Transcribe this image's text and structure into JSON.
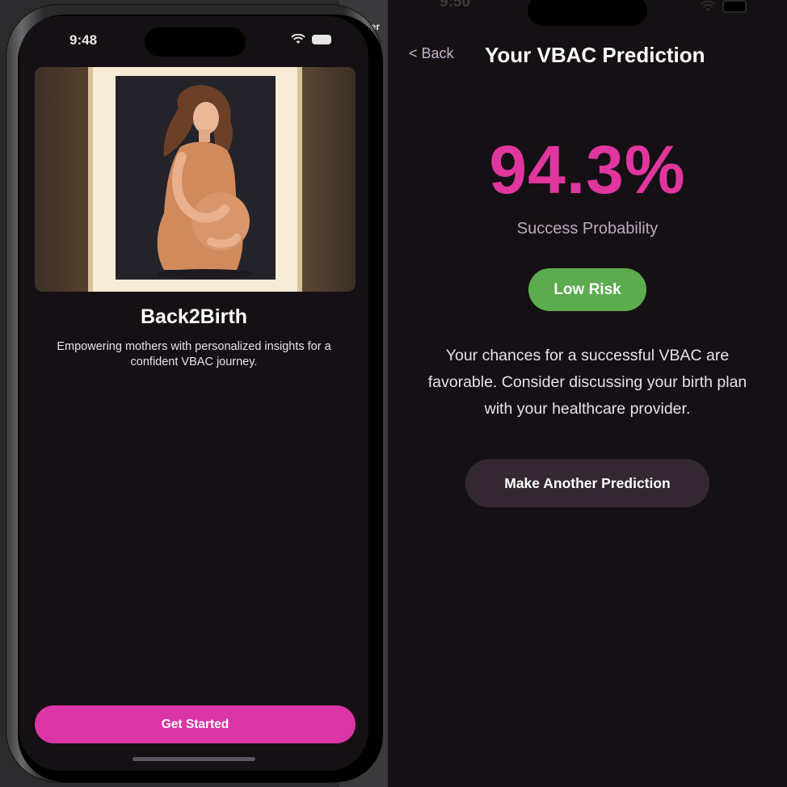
{
  "left_screen": {
    "status_time": "9:48",
    "background_fragment": "ller",
    "app_name": "Back2Birth",
    "tagline": "Empowering mothers with personalized insights for a confident VBAC journey.",
    "primary_button_label": "Get Started",
    "accent_color": "#dc35a5"
  },
  "right_screen": {
    "status_time": "9:50",
    "back_label": "< Back",
    "title": "Your VBAC Prediction",
    "success_percentage": "94.3%",
    "success_label": "Success Probability",
    "risk_level": "Low Risk",
    "risk_color": "#5cac4f",
    "advice": "Your chances for a successful VBAC are favorable. Consider discussing your birth plan with your healthcare provider.",
    "repeat_button_label": "Make Another Prediction",
    "percentage_color": "#e0369e"
  }
}
